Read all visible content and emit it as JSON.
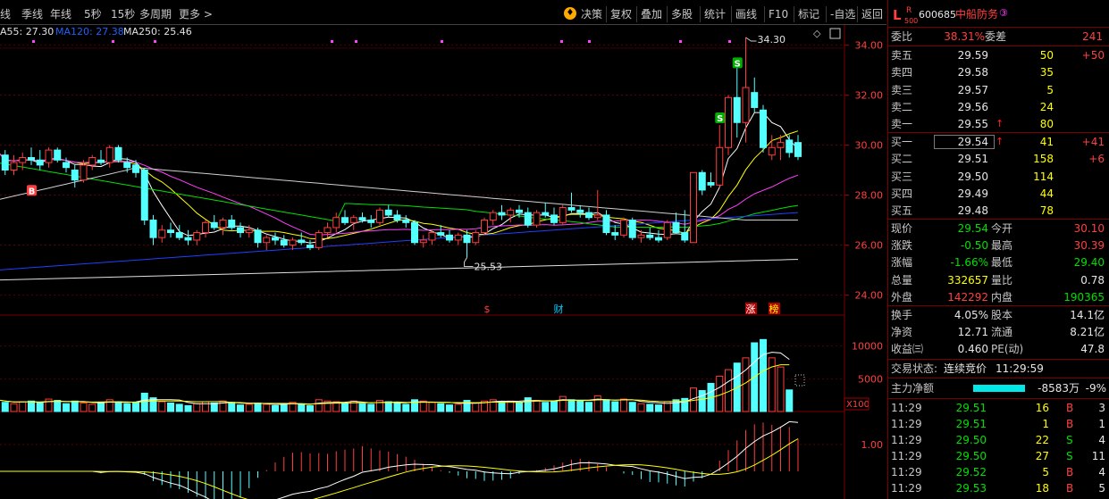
{
  "toolbar": {
    "left": [
      {
        "label": "线"
      },
      {
        "label": "季线"
      },
      {
        "label": "年线"
      },
      {
        "label": "5秒"
      },
      {
        "label": "15秒"
      },
      {
        "label": "多周期"
      },
      {
        "label": "更多 >"
      }
    ],
    "right": [
      {
        "label": "决策",
        "icon": "lightbulb-icon"
      },
      {
        "label": "复权"
      },
      {
        "label": "叠加"
      },
      {
        "label": "多股"
      },
      {
        "label": "统计"
      },
      {
        "label": "画线"
      },
      {
        "label": "F10"
      },
      {
        "label": "标记"
      },
      {
        "label": "-自选"
      },
      {
        "label": "返回"
      }
    ]
  },
  "ma_legend": {
    "ma55": "A55: 27.30",
    "ma120": "MA120: 27.38",
    "ma250": "MA250: 25.46"
  },
  "price_axis": [
    {
      "v": 34,
      "label": "34.00"
    },
    {
      "v": 32,
      "label": "32.00"
    },
    {
      "v": 30,
      "label": "30.00"
    },
    {
      "v": 28,
      "label": "28.00"
    },
    {
      "v": 26,
      "label": "26.00"
    },
    {
      "v": 24,
      "label": "24.00"
    }
  ],
  "vol_axis": [
    {
      "v": 10000,
      "label": "10000"
    },
    {
      "v": 5000,
      "label": "5000"
    }
  ],
  "vol_unit": "X100",
  "macd_axis": [
    {
      "v": 1,
      "label": "1.00"
    }
  ],
  "annotations": {
    "high": "34.30",
    "low": "25.53",
    "events": [
      {
        "label": "$",
        "color": "#ff4040"
      },
      {
        "label": "财",
        "color": "#00d0ff"
      },
      {
        "label": "涨",
        "color": "#ffffff",
        "bg": "#b00000"
      },
      {
        "label": "榜",
        "color": "#ffff00",
        "bg": "#b00000"
      }
    ],
    "markers": [
      "B",
      "S",
      "S"
    ]
  },
  "chart_data": {
    "type": "candlestick",
    "ohlc": [
      [
        28.6,
        29.9,
        28.5,
        29.8
      ],
      [
        29.6,
        29.8,
        28.8,
        29.0
      ],
      [
        29.0,
        29.6,
        28.8,
        29.3
      ],
      [
        29.3,
        29.7,
        29.0,
        29.5
      ],
      [
        29.5,
        29.9,
        29.2,
        29.4
      ],
      [
        29.4,
        29.8,
        29.0,
        29.2
      ],
      [
        29.3,
        29.9,
        29.1,
        29.8
      ],
      [
        29.8,
        29.9,
        29.3,
        29.4
      ],
      [
        29.3,
        29.5,
        28.9,
        29.1
      ],
      [
        29.0,
        29.2,
        28.3,
        28.6
      ],
      [
        28.6,
        29.4,
        28.5,
        29.2
      ],
      [
        29.2,
        29.6,
        29.0,
        29.5
      ],
      [
        29.4,
        29.8,
        29.2,
        29.3
      ],
      [
        29.3,
        30.0,
        29.1,
        29.9
      ],
      [
        29.9,
        30.0,
        29.3,
        29.4
      ],
      [
        29.3,
        29.5,
        28.9,
        29.1
      ],
      [
        29.2,
        29.4,
        28.7,
        28.9
      ],
      [
        29.0,
        29.1,
        26.8,
        27.0
      ],
      [
        27.0,
        27.2,
        26.0,
        26.3
      ],
      [
        26.3,
        26.8,
        26.1,
        26.6
      ],
      [
        26.6,
        26.9,
        26.3,
        26.5
      ],
      [
        26.5,
        26.8,
        26.2,
        26.3
      ],
      [
        26.3,
        26.6,
        26.0,
        26.2
      ],
      [
        26.2,
        26.6,
        26.0,
        26.5
      ],
      [
        26.5,
        27.0,
        26.3,
        26.9
      ],
      [
        26.9,
        27.2,
        26.6,
        26.7
      ],
      [
        26.7,
        27.1,
        26.4,
        27.0
      ],
      [
        27.0,
        27.2,
        26.6,
        26.7
      ],
      [
        26.7,
        26.9,
        26.3,
        26.5
      ],
      [
        26.5,
        26.8,
        26.3,
        26.6
      ],
      [
        26.6,
        26.7,
        25.9,
        26.1
      ],
      [
        26.1,
        26.4,
        25.8,
        26.3
      ],
      [
        26.3,
        26.5,
        26.0,
        26.2
      ],
      [
        26.2,
        26.4,
        25.9,
        26.0
      ],
      [
        26.0,
        26.3,
        25.8,
        26.2
      ],
      [
        26.2,
        26.5,
        26.0,
        26.1
      ],
      [
        26.0,
        26.2,
        25.8,
        25.9
      ],
      [
        25.9,
        26.6,
        25.8,
        26.5
      ],
      [
        26.5,
        26.9,
        26.3,
        26.7
      ],
      [
        26.7,
        27.3,
        26.5,
        27.1
      ],
      [
        27.1,
        27.4,
        26.8,
        26.9
      ],
      [
        26.9,
        27.2,
        26.6,
        27.1
      ],
      [
        27.1,
        27.3,
        26.9,
        27.0
      ],
      [
        27.0,
        27.2,
        26.7,
        26.9
      ],
      [
        26.9,
        27.5,
        26.8,
        27.4
      ],
      [
        27.4,
        27.6,
        27.1,
        27.2
      ],
      [
        27.2,
        27.4,
        26.9,
        27.0
      ],
      [
        27.0,
        27.2,
        26.7,
        26.9
      ],
      [
        26.9,
        27.0,
        26.0,
        26.1
      ],
      [
        26.1,
        26.4,
        25.9,
        26.2
      ],
      [
        26.2,
        26.6,
        26.0,
        26.5
      ],
      [
        26.5,
        26.8,
        26.3,
        26.4
      ],
      [
        26.4,
        26.6,
        26.1,
        26.2
      ],
      [
        26.2,
        26.5,
        26.0,
        26.4
      ],
      [
        26.4,
        26.6,
        25.5,
        26.1
      ],
      [
        26.1,
        26.6,
        26.0,
        26.5
      ],
      [
        26.5,
        27.1,
        26.4,
        27.0
      ],
      [
        27.0,
        27.4,
        26.8,
        27.3
      ],
      [
        27.3,
        27.6,
        27.0,
        27.2
      ],
      [
        27.2,
        27.5,
        26.9,
        27.4
      ],
      [
        27.4,
        27.6,
        27.1,
        27.3
      ],
      [
        27.3,
        27.5,
        26.7,
        26.8
      ],
      [
        26.8,
        27.4,
        26.7,
        27.3
      ],
      [
        27.3,
        27.7,
        27.1,
        27.2
      ],
      [
        27.2,
        27.5,
        26.8,
        26.9
      ],
      [
        26.9,
        27.6,
        26.8,
        27.5
      ],
      [
        27.5,
        28.1,
        27.3,
        27.4
      ],
      [
        27.4,
        27.6,
        27.1,
        27.3
      ],
      [
        27.3,
        27.5,
        27.0,
        27.1
      ],
      [
        27.1,
        28.2,
        27.0,
        27.2
      ],
      [
        27.2,
        27.4,
        26.4,
        26.5
      ],
      [
        26.5,
        26.8,
        26.2,
        26.4
      ],
      [
        26.4,
        27.1,
        26.3,
        27.0
      ],
      [
        27.0,
        27.1,
        26.2,
        26.3
      ],
      [
        26.3,
        26.6,
        26.1,
        26.4
      ],
      [
        26.4,
        26.7,
        26.2,
        26.3
      ],
      [
        26.3,
        26.6,
        26.1,
        26.2
      ],
      [
        26.3,
        27.0,
        26.2,
        26.9
      ],
      [
        26.9,
        27.3,
        26.7,
        26.5
      ],
      [
        26.5,
        27.4,
        26.1,
        26.2
      ],
      [
        26.1,
        28.0,
        26.1,
        28.9
      ],
      [
        28.9,
        29.0,
        28.0,
        28.2
      ],
      [
        28.5,
        28.9,
        28.3,
        28.4
      ],
      [
        28.4,
        30.8,
        28.3,
        29.9
      ],
      [
        29.9,
        32.0,
        29.6,
        31.9
      ],
      [
        31.9,
        33.2,
        30.3,
        30.9
      ],
      [
        30.9,
        34.3,
        30.1,
        32.3
      ],
      [
        32.1,
        32.7,
        31.3,
        31.5
      ],
      [
        31.4,
        31.6,
        29.7,
        29.9
      ],
      [
        29.6,
        30.4,
        29.4,
        29.9
      ],
      [
        29.9,
        30.4,
        29.4,
        30.1
      ],
      [
        30.2,
        30.4,
        29.5,
        29.7
      ],
      [
        30.1,
        30.4,
        29.4,
        29.54
      ]
    ],
    "volume": [
      1800,
      1400,
      1200,
      1500,
      1600,
      1300,
      1900,
      1700,
      1200,
      1600,
      1300,
      1100,
      1400,
      1800,
      1500,
      1200,
      1400,
      2800,
      2100,
      1500,
      1300,
      1100,
      900,
      1200,
      1500,
      1300,
      1600,
      1400,
      1000,
      1100,
      1300,
      1100,
      900,
      1200,
      1400,
      1100,
      900,
      1800,
      1600,
      1500,
      1300,
      1600,
      1200,
      1100,
      1700,
      1500,
      1300,
      1100,
      1800,
      1600,
      1400,
      1200,
      1000,
      1100,
      1700,
      1300,
      1600,
      1800,
      1500,
      1600,
      1400,
      2100,
      1700,
      1400,
      1600,
      2300,
      1800,
      1600,
      1400,
      2400,
      1800,
      1500,
      1900,
      1400,
      1200,
      1100,
      1000,
      1500,
      1800,
      2000,
      3600,
      3200,
      4300,
      5400,
      6400,
      7400,
      8200,
      10500,
      11000,
      8200,
      6800,
      3300
    ],
    "ma": {
      "5": {
        "color": "#ffffff"
      },
      "10": {
        "color": "#ffff00"
      },
      "20": {
        "color": "#ff40ff"
      },
      "55": {
        "color": "#00ff00"
      },
      "120": {
        "color": "#2040ff"
      },
      "250": {
        "color": "#e0e0e0"
      }
    },
    "ylim": [
      23.2,
      34.8
    ],
    "vol_ylim": [
      0,
      12000
    ]
  },
  "quote": {
    "code": "600685",
    "name": "中船防务",
    "badge_top": "R",
    "badge_bottom": "500",
    "letter": "L",
    "weibi_label": "委比",
    "weibi": "38.31%",
    "weicha_label": "委差",
    "weicha": "241",
    "asks": [
      {
        "label": "卖五",
        "price": "29.59",
        "vol": "50",
        "chg": "+50"
      },
      {
        "label": "卖四",
        "price": "29.58",
        "vol": "35",
        "chg": ""
      },
      {
        "label": "卖三",
        "price": "29.57",
        "vol": "5",
        "chg": ""
      },
      {
        "label": "卖二",
        "price": "29.56",
        "vol": "24",
        "chg": ""
      },
      {
        "label": "卖一",
        "price": "29.55",
        "vol": "80",
        "chg": ""
      }
    ],
    "bids": [
      {
        "label": "买一",
        "price": "29.54",
        "vol": "41",
        "chg": "+41"
      },
      {
        "label": "买二",
        "price": "29.51",
        "vol": "158",
        "chg": "+6"
      },
      {
        "label": "买三",
        "price": "29.50",
        "vol": "114",
        "chg": ""
      },
      {
        "label": "买四",
        "price": "29.49",
        "vol": "44",
        "chg": ""
      },
      {
        "label": "买五",
        "price": "29.48",
        "vol": "78",
        "chg": ""
      }
    ],
    "stats": [
      {
        "l1": "现价",
        "v1": "29.54",
        "l2": "今开",
        "v2": "30.10"
      },
      {
        "l1": "涨跌",
        "v1": "-0.50",
        "l2": "最高",
        "v2": "30.39"
      },
      {
        "l1": "涨幅",
        "v1": "-1.66%",
        "l2": "最低",
        "v2": "29.40"
      },
      {
        "l1": "总量",
        "v1": "332657",
        "l2": "量比",
        "v2": "0.78"
      },
      {
        "l1": "外盘",
        "v1": "142292",
        "l2": "内盘",
        "v2": "190365"
      }
    ],
    "stats2": [
      {
        "l1": "换手",
        "v1": "4.05%",
        "l2": "股本",
        "v2": "14.1亿"
      },
      {
        "l1": "净资",
        "v1": "12.71",
        "l2": "流通",
        "v2": "8.21亿"
      },
      {
        "l1": "收益㈢",
        "v1": "0.460",
        "l2": "PE(动)",
        "v2": "47.8"
      }
    ],
    "trade_status_label": "交易状态:",
    "trade_status": "连续竞价",
    "trade_time": "11:29:59",
    "main_flow_label": "主力净额",
    "main_flow": "-8583万",
    "main_flow_pct": "-9%",
    "ticks": [
      {
        "t": "11:29",
        "p": "29.51",
        "v": "16",
        "d": "B",
        "n": "3"
      },
      {
        "t": "11:29",
        "p": "29.51",
        "v": "1",
        "d": "B",
        "n": "1"
      },
      {
        "t": "11:29",
        "p": "29.50",
        "v": "22",
        "d": "S",
        "n": "4"
      },
      {
        "t": "11:29",
        "p": "29.50",
        "v": "27",
        "d": "S",
        "n": "11"
      },
      {
        "t": "11:29",
        "p": "29.52",
        "v": "5",
        "d": "B",
        "n": "4"
      },
      {
        "t": "11:29",
        "p": "29.53",
        "v": "18",
        "d": "B",
        "n": "5"
      }
    ]
  }
}
